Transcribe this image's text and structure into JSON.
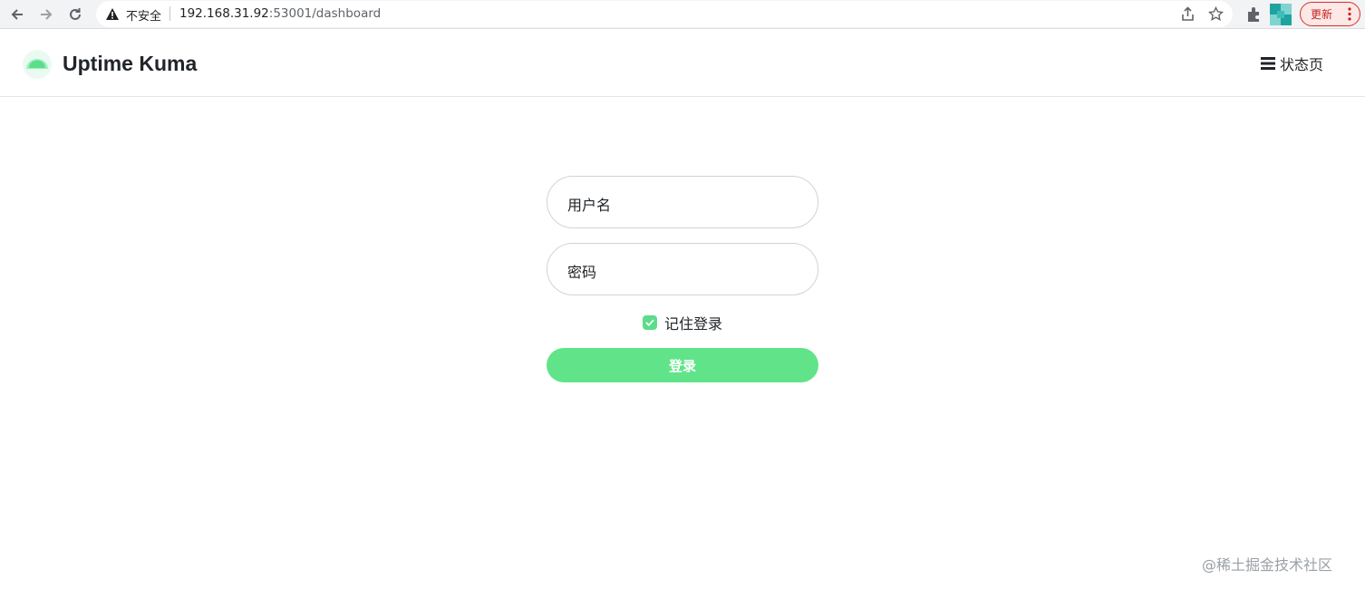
{
  "browser": {
    "security_label": "不安全",
    "url_host": "192.168.31.92",
    "url_rest": ":53001/dashboard",
    "update_label": "更新"
  },
  "header": {
    "brand": "Uptime Kuma",
    "status_page_label": "状态页"
  },
  "login": {
    "username_placeholder": "用户名",
    "password_placeholder": "密码",
    "remember_label": "记住登录",
    "remember_checked": true,
    "submit_label": "登录"
  },
  "colors": {
    "accent": "#5cdd8b",
    "button": "#61e489"
  },
  "watermark": "@稀土掘金技术社区"
}
